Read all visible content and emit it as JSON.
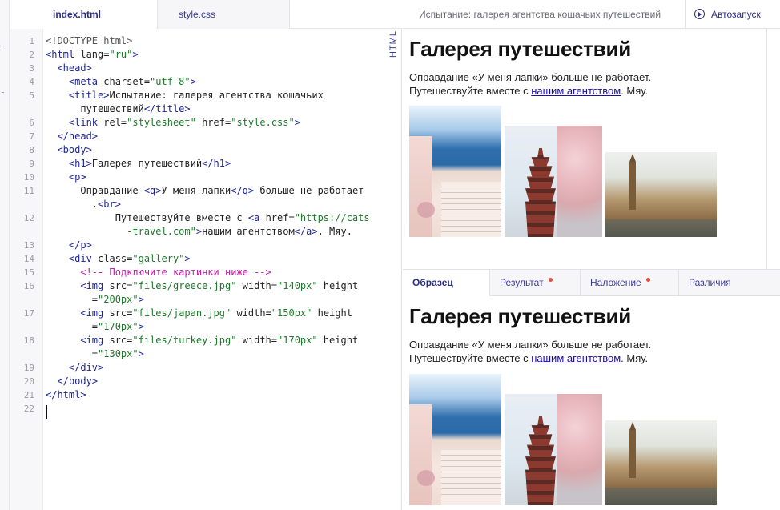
{
  "editor": {
    "tabs": [
      {
        "label": "index.html",
        "active": true
      },
      {
        "label": "style.css",
        "active": false
      }
    ],
    "side_label": "HTML",
    "lines": [
      {
        "n": "1",
        "parts": [
          {
            "c": "dt",
            "t": "<!DOCTYPE html>"
          }
        ]
      },
      {
        "n": "2",
        "parts": [
          {
            "c": "tg",
            "t": "<html "
          },
          {
            "c": "at",
            "t": "lang="
          },
          {
            "c": "st",
            "t": "\"ru\""
          },
          {
            "c": "tg",
            "t": ">"
          }
        ]
      },
      {
        "n": "3",
        "parts": [
          {
            "c": "tg",
            "t": "  <head>"
          }
        ]
      },
      {
        "n": "4",
        "parts": [
          {
            "c": "tg",
            "t": "    <meta "
          },
          {
            "c": "at",
            "t": "charset="
          },
          {
            "c": "st",
            "t": "\"utf-8\""
          },
          {
            "c": "tg",
            "t": ">"
          }
        ]
      },
      {
        "n": "5",
        "parts": [
          {
            "c": "tg",
            "t": "    <title>"
          },
          {
            "c": "at",
            "t": "Испытание: галерея агентства кошачьих"
          }
        ]
      },
      {
        "n": "",
        "parts": [
          {
            "c": "at",
            "t": "      путешествий"
          },
          {
            "c": "tg",
            "t": "</title>"
          }
        ]
      },
      {
        "n": "6",
        "parts": [
          {
            "c": "tg",
            "t": "    <link "
          },
          {
            "c": "at",
            "t": "rel="
          },
          {
            "c": "st",
            "t": "\"stylesheet\""
          },
          {
            "c": "at",
            "t": " href="
          },
          {
            "c": "st",
            "t": "\"style.css\""
          },
          {
            "c": "tg",
            "t": ">"
          }
        ]
      },
      {
        "n": "7",
        "parts": [
          {
            "c": "tg",
            "t": "  </head>"
          }
        ]
      },
      {
        "n": "8",
        "parts": [
          {
            "c": "tg",
            "t": "  <body>"
          }
        ]
      },
      {
        "n": "9",
        "parts": [
          {
            "c": "tg",
            "t": "    <h1>"
          },
          {
            "c": "at",
            "t": "Галерея путешествий"
          },
          {
            "c": "tg",
            "t": "</h1>"
          }
        ]
      },
      {
        "n": "10",
        "parts": [
          {
            "c": "tg",
            "t": "    <p>"
          }
        ]
      },
      {
        "n": "11",
        "parts": [
          {
            "c": "at",
            "t": "      Оправдание "
          },
          {
            "c": "tg",
            "t": "<q>"
          },
          {
            "c": "at",
            "t": "У меня лапки"
          },
          {
            "c": "tg",
            "t": "</q>"
          },
          {
            "c": "at",
            "t": " больше не работает"
          }
        ]
      },
      {
        "n": "",
        "parts": [
          {
            "c": "at",
            "t": "        ."
          },
          {
            "c": "tg",
            "t": "<br>"
          }
        ]
      },
      {
        "n": "12",
        "parts": [
          {
            "c": "at",
            "t": "            Путешествуйте вместе с "
          },
          {
            "c": "tg",
            "t": "<a "
          },
          {
            "c": "at",
            "t": "href="
          },
          {
            "c": "st",
            "t": "\"https://cats"
          }
        ]
      },
      {
        "n": "",
        "parts": [
          {
            "c": "st",
            "t": "              -travel.com\""
          },
          {
            "c": "tg",
            "t": ">"
          },
          {
            "c": "at",
            "t": "нашим агентством"
          },
          {
            "c": "tg",
            "t": "</a>"
          },
          {
            "c": "at",
            "t": ". Мяу."
          }
        ]
      },
      {
        "n": "13",
        "parts": [
          {
            "c": "tg",
            "t": "    </p>"
          }
        ]
      },
      {
        "n": "14",
        "parts": [
          {
            "c": "tg",
            "t": "    <div "
          },
          {
            "c": "at",
            "t": "class="
          },
          {
            "c": "st",
            "t": "\"gallery\""
          },
          {
            "c": "tg",
            "t": ">"
          }
        ]
      },
      {
        "n": "15",
        "parts": [
          {
            "c": "cm",
            "t": "      <!-- Подключите картинки ниже -->"
          }
        ]
      },
      {
        "n": "16",
        "parts": [
          {
            "c": "tg",
            "t": "      <img "
          },
          {
            "c": "at",
            "t": "src="
          },
          {
            "c": "st",
            "t": "\"files/greece.jpg\""
          },
          {
            "c": "at",
            "t": " width="
          },
          {
            "c": "st",
            "t": "\"140px\""
          },
          {
            "c": "at",
            "t": " height"
          }
        ]
      },
      {
        "n": "",
        "parts": [
          {
            "c": "at",
            "t": "        ="
          },
          {
            "c": "st",
            "t": "\"200px\""
          },
          {
            "c": "tg",
            "t": ">"
          }
        ]
      },
      {
        "n": "17",
        "parts": [
          {
            "c": "tg",
            "t": "      <img "
          },
          {
            "c": "at",
            "t": "src="
          },
          {
            "c": "st",
            "t": "\"files/japan.jpg\""
          },
          {
            "c": "at",
            "t": " width="
          },
          {
            "c": "st",
            "t": "\"150px\""
          },
          {
            "c": "at",
            "t": " height"
          }
        ]
      },
      {
        "n": "",
        "parts": [
          {
            "c": "at",
            "t": "        ="
          },
          {
            "c": "st",
            "t": "\"170px\""
          },
          {
            "c": "tg",
            "t": ">"
          }
        ]
      },
      {
        "n": "18",
        "parts": [
          {
            "c": "tg",
            "t": "      <img "
          },
          {
            "c": "at",
            "t": "src="
          },
          {
            "c": "st",
            "t": "\"files/turkey.jpg\""
          },
          {
            "c": "at",
            "t": " width="
          },
          {
            "c": "st",
            "t": "\"170px\""
          },
          {
            "c": "at",
            "t": " height"
          }
        ]
      },
      {
        "n": "",
        "parts": [
          {
            "c": "at",
            "t": "        ="
          },
          {
            "c": "st",
            "t": "\"130px\""
          },
          {
            "c": "tg",
            "t": ">"
          }
        ]
      },
      {
        "n": "19",
        "parts": [
          {
            "c": "tg",
            "t": "    </div>"
          }
        ]
      },
      {
        "n": "20",
        "parts": [
          {
            "c": "tg",
            "t": "  </body>"
          }
        ]
      },
      {
        "n": "21",
        "parts": [
          {
            "c": "tg",
            "t": "</html>"
          }
        ]
      },
      {
        "n": "22",
        "parts": []
      }
    ]
  },
  "preview_header": {
    "title": "Испытание: галерея агентства кошачьих путешествий",
    "autorun_label": "Автозапуск"
  },
  "page": {
    "h1": "Галерея путешествий",
    "p_line1": "Оправдание «У меня лапки» больше не работает.",
    "p_line2_prefix": "Путешествуйте вместе с ",
    "link_text": "нашим агентством",
    "p_line2_suffix": ". Мяу."
  },
  "result_tabs": [
    {
      "label": "Образец",
      "active": true,
      "dot": false
    },
    {
      "label": "Результат",
      "active": false,
      "dot": true
    },
    {
      "label": "Наложение",
      "active": false,
      "dot": true
    },
    {
      "label": "Различия",
      "active": false,
      "dot": false
    }
  ],
  "colors": {
    "accent": "#2a2c85",
    "tag": "#1e2596",
    "string": "#1d7a2a",
    "comment": "#c21fa8",
    "dot": "#e84a3a",
    "link": "#1a0dab"
  }
}
